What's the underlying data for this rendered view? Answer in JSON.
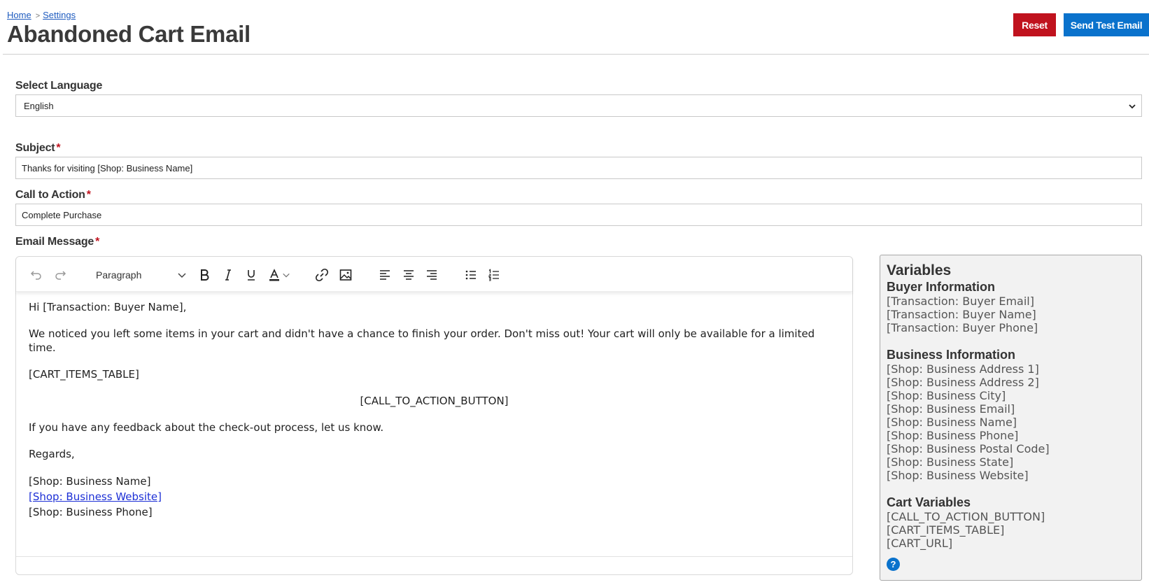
{
  "breadcrumb": {
    "home": "Home",
    "sep": ">",
    "settings": "Settings"
  },
  "page_title": "Abandoned Cart Email",
  "header_buttons": {
    "reset": "Reset",
    "send_test": "Send Test Email"
  },
  "colors": {
    "reset": "#c0121e",
    "send_test": "#0a72cc",
    "required": "#c0121e",
    "link": "#1c2fd6"
  },
  "language": {
    "label": "Select Language",
    "value": "English"
  },
  "subject": {
    "label": "Subject",
    "required": "*",
    "value": "Thanks for visiting [Shop: Business Name]"
  },
  "cta": {
    "label": "Call to Action",
    "required": "*",
    "value": "Complete Purchase"
  },
  "message": {
    "label": "Email Message",
    "required": "*",
    "toolbar": {
      "block_format": "Paragraph",
      "icons": [
        "undo-icon",
        "redo-icon",
        "chevron-down-icon",
        "bold-icon",
        "italic-icon",
        "underline-icon",
        "text-color-icon",
        "link-icon",
        "image-icon",
        "align-left-icon",
        "align-center-icon",
        "align-right-icon",
        "bullet-list-icon",
        "numbered-list-icon"
      ]
    },
    "greeting": "Hi [Transaction: Buyer Name],",
    "body": "We noticed you left some items in your cart and didn't have a chance to finish your order. Don't miss out! Your cart will only be available for a limited time.",
    "cart_table": "[CART_ITEMS_TABLE]",
    "cta_button": "[CALL_TO_ACTION_BUTTON]",
    "feedback": "If you have any feedback about the check-out process, let us know.",
    "regards": "Regards,",
    "sig_name": "[Shop: Business Name]",
    "sig_website": "[Shop: Business Website]",
    "sig_phone": "[Shop: Business Phone]"
  },
  "variables": {
    "title": "Variables",
    "groups": [
      {
        "title": "Buyer Information",
        "items": [
          "[Transaction: Buyer Email]",
          "[Transaction: Buyer Name]",
          "[Transaction: Buyer Phone]"
        ]
      },
      {
        "title": "Business Information",
        "items": [
          "[Shop: Business Address 1]",
          "[Shop: Business Address 2]",
          "[Shop: Business City]",
          "[Shop: Business Email]",
          "[Shop: Business Name]",
          "[Shop: Business Phone]",
          "[Shop: Business Postal Code]",
          "[Shop: Business State]",
          "[Shop: Business Website]"
        ]
      },
      {
        "title": "Cart Variables",
        "items": [
          "[CALL_TO_ACTION_BUTTON]",
          "[CART_ITEMS_TABLE]",
          "[CART_URL]"
        ]
      }
    ],
    "help": "?"
  }
}
